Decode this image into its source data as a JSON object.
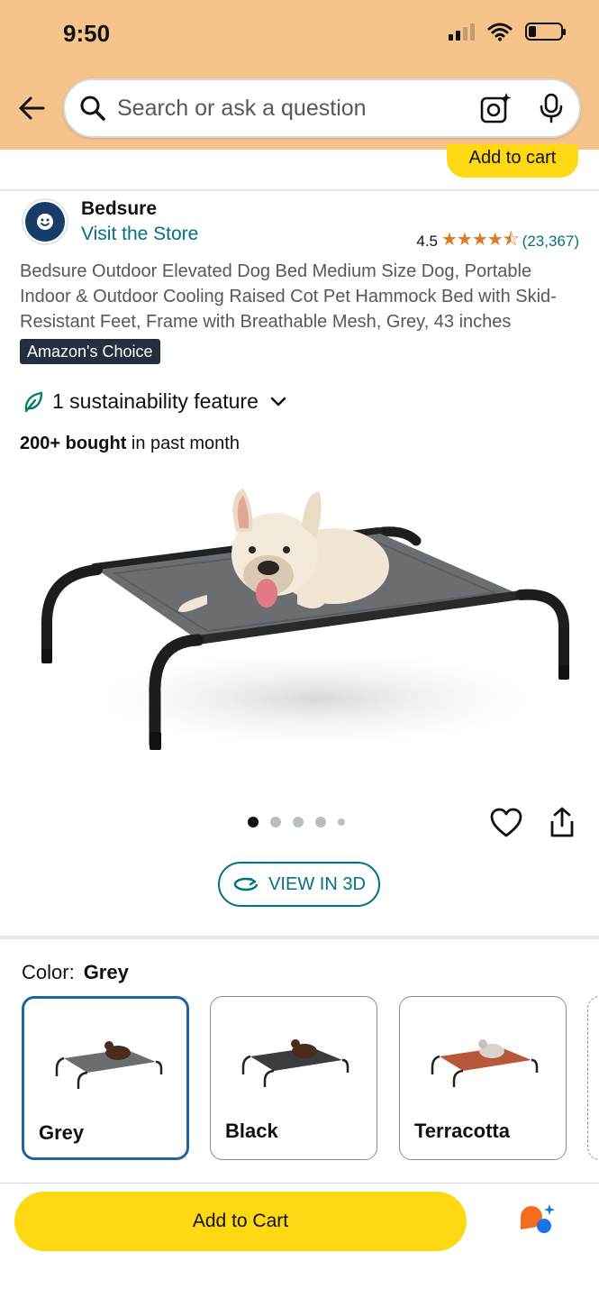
{
  "status_bar": {
    "time": "9:50"
  },
  "search": {
    "placeholder": "Search or ask a question"
  },
  "sticky": {
    "add_to_cart": "Add to cart"
  },
  "brand": {
    "name": "Bedsure",
    "visit_store": "Visit the Store"
  },
  "rating": {
    "value": "4.5",
    "stars": "★★★★⯪",
    "count": "(23,367)"
  },
  "product": {
    "title": "Bedsure Outdoor Elevated Dog Bed Medium Size Dog, Portable Indoor & Outdoor Cooling Raised Cot Pet Hammock Bed with Skid-Resistant Feet, Frame with Breathable Mesh, Grey, 43 inches",
    "badge": "Amazon's Choice",
    "sustainability": "1 sustainability feature",
    "bought_bold": "200+ bought",
    "bought_rest": " in past month",
    "view_3d": "VIEW IN 3D",
    "image_index": {
      "current": 1,
      "total": 5
    }
  },
  "color": {
    "label": "Color:",
    "selected": "Grey",
    "options": [
      {
        "name": "Grey",
        "bed_color": "#6b6e71"
      },
      {
        "name": "Black",
        "bed_color": "#3a3c3e"
      },
      {
        "name": "Terracotta",
        "bed_color": "#b8583a"
      }
    ]
  },
  "bottom": {
    "add_to_cart": "Add to Cart"
  },
  "colors": {
    "header_bg": "#f6c48a",
    "button_yellow": "#ffd814",
    "link_teal": "#007185",
    "star_orange": "#de7921",
    "badge_navy": "#232f3e"
  },
  "icons": [
    "back-arrow-icon",
    "search-icon",
    "camera-lens-icon",
    "mic-icon",
    "leaf-icon",
    "chevron-down-icon",
    "heart-icon",
    "share-icon",
    "rotate-3d-icon",
    "assistant-icon"
  ]
}
